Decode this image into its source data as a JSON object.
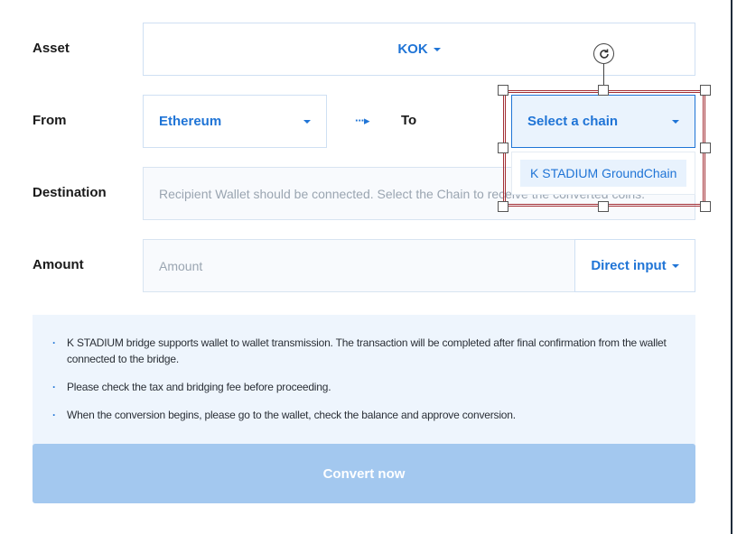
{
  "form": {
    "asset_label": "Asset",
    "asset_value": "KOK",
    "from_label": "From",
    "from_value": "Ethereum",
    "arrow_glyph": "···▸",
    "to_label": "To",
    "to_select_value": "Select a chain",
    "destination_label": "Destination",
    "destination_placeholder": "Recipient Wallet should be connected. Select the Chain to receive the converted coins.",
    "amount_label": "Amount",
    "amount_placeholder": "Amount",
    "direct_input_label": "Direct input"
  },
  "chain_dropdown": {
    "options": [
      "K STADIUM GroundChain"
    ]
  },
  "notice": {
    "items": [
      "K STADIUM bridge supports wallet to wallet transmission. The transaction will be completed after final confirmation from the wallet connected to the bridge.",
      "Please check the tax and bridging fee before proceeding.",
      "When the conversion begins, please go to the wallet, check the balance and approve conversion."
    ],
    "bullet": "·"
  },
  "convert_button": {
    "label": "Convert now"
  },
  "colors": {
    "accent": "#1f74d6",
    "button_disabled": "#a3c8ef",
    "notice_bg": "#eef5fd",
    "selection_border": "#a32f35"
  },
  "icons": {
    "caret": "caret-down-icon",
    "rotate": "rotate-icon",
    "arrow": "dotted-arrow-right-icon"
  }
}
